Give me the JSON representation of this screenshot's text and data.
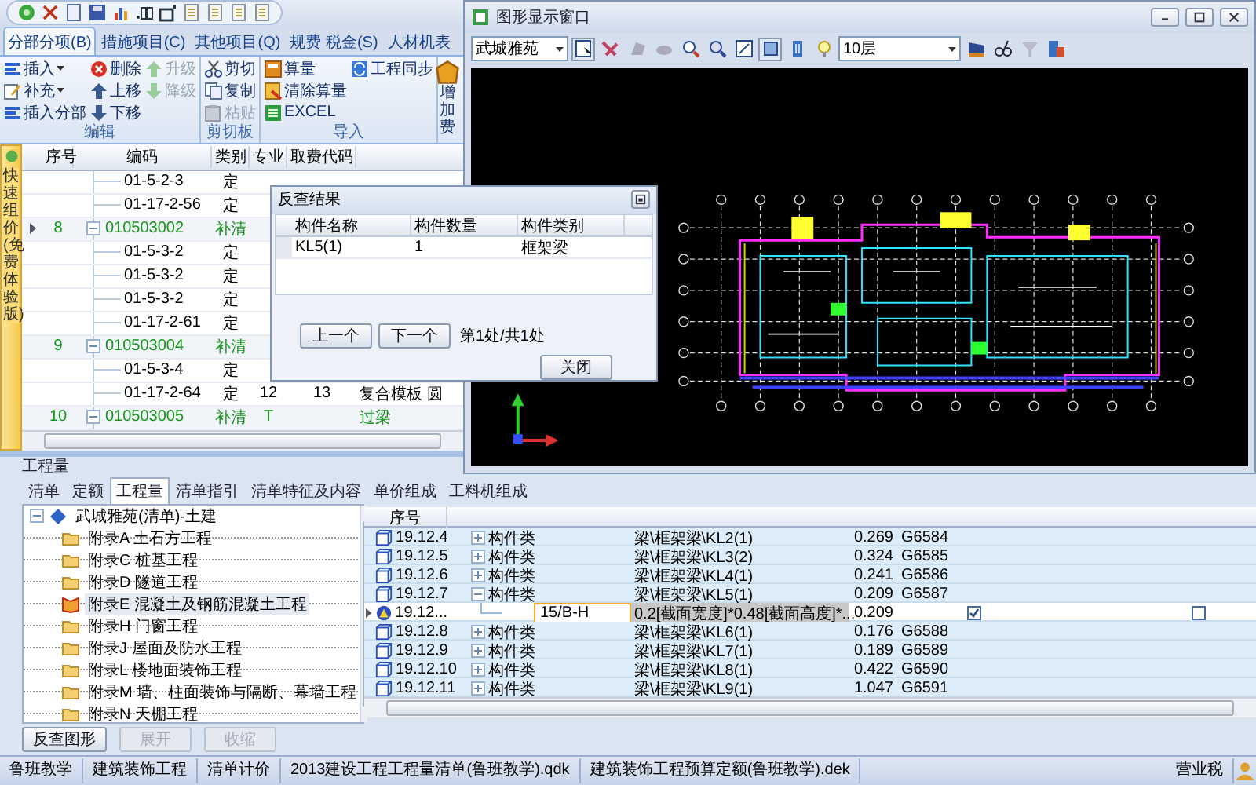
{
  "ribbon_tabs": [
    {
      "label": "分部分项(B)",
      "selected": true
    },
    {
      "label": "措施项目(C)",
      "selected": false
    },
    {
      "label": "其他项目(Q)",
      "selected": false
    },
    {
      "label": "规费 税金(S)",
      "selected": false
    },
    {
      "label": "人材机表",
      "selected": false
    }
  ],
  "ribbon_groups": [
    {
      "label": "编辑",
      "columns": [
        [
          {
            "label": "插入",
            "dropdown": true,
            "disabled": false
          },
          {
            "label": "补充",
            "dropdown": true,
            "disabled": false
          },
          {
            "label": "插入分部",
            "dropdown": false,
            "disabled": false
          }
        ],
        [
          {
            "label": "删除",
            "dropdown": false,
            "disabled": false
          },
          {
            "label": "上移",
            "dropdown": false,
            "disabled": false
          },
          {
            "label": "下移",
            "dropdown": false,
            "disabled": false
          }
        ],
        [
          {
            "label": "升级",
            "dropdown": false,
            "disabled": true
          },
          {
            "label": "降级",
            "dropdown": false,
            "disabled": true
          }
        ]
      ]
    },
    {
      "label": "剪切板",
      "columns": [
        [
          {
            "label": "剪切",
            "dropdown": false,
            "disabled": false
          },
          {
            "label": "复制",
            "dropdown": false,
            "disabled": false
          },
          {
            "label": "粘贴",
            "dropdown": false,
            "disabled": true
          }
        ]
      ]
    },
    {
      "label": "导入",
      "columns": [
        [
          {
            "label": "算量",
            "dropdown": false,
            "disabled": false
          },
          {
            "label": "清除算量",
            "dropdown": false,
            "disabled": false
          },
          {
            "label": "EXCEL",
            "dropdown": false,
            "disabled": false
          }
        ],
        [
          {
            "label": "工程同步",
            "dropdown": false,
            "disabled": false
          }
        ]
      ]
    }
  ],
  "ribbon_large_button": {
    "label": "增加费"
  },
  "side_tab": "快速组价(免费体验版)",
  "upper_grid": {
    "columns": [
      "序号",
      "编码",
      "类别",
      "专业",
      "取费代码"
    ],
    "rows": [
      {
        "kind": "quota",
        "code": "01-5-2-3",
        "type": "定",
        "selected": false
      },
      {
        "kind": "quota",
        "code": "01-17-2-56",
        "type": "定",
        "selected": false
      },
      {
        "kind": "bill",
        "index": "8",
        "code": "010503002",
        "type": "补清",
        "expanded": true,
        "selected": true
      },
      {
        "kind": "quota",
        "code": "01-5-3-2",
        "type": "定",
        "selected": false
      },
      {
        "kind": "quota",
        "code": "01-5-3-2",
        "type": "定",
        "selected": false
      },
      {
        "kind": "quota",
        "code": "01-5-3-2",
        "type": "定",
        "selected": false
      },
      {
        "kind": "quota",
        "code": "01-17-2-61",
        "type": "定",
        "selected": false
      },
      {
        "kind": "bill",
        "index": "9",
        "code": "010503004",
        "type": "补清",
        "expanded": true,
        "selected": false
      },
      {
        "kind": "quota",
        "code": "01-5-3-4",
        "type": "定",
        "selected": false
      },
      {
        "kind": "quota",
        "code": "01-17-2-64",
        "type": "定",
        "specialty": "12",
        "fee_code": "13",
        "name": "复合模板 圆",
        "selected": false
      },
      {
        "kind": "bill",
        "index": "10",
        "code": "010503005",
        "type": "补清",
        "specialty": "T",
        "name": "过梁",
        "expanded": true,
        "selected": false
      }
    ]
  },
  "graphics_window": {
    "title": "图形显示窗口",
    "building": "武城雅苑",
    "floor": "10层"
  },
  "dialog": {
    "title": "反查结果",
    "columns": [
      "构件名称",
      "构件数量",
      "构件类别"
    ],
    "rows": [
      [
        "KL5(1)",
        "1",
        "框架梁"
      ]
    ],
    "buttons": [
      "上一个",
      "下一个"
    ],
    "position": "第1处/共1处",
    "close": "关闭"
  },
  "lower_panel": {
    "title": "工程量",
    "tabs": [
      {
        "label": "清单",
        "selected": false
      },
      {
        "label": "定额",
        "selected": false
      },
      {
        "label": "工程量",
        "selected": true
      },
      {
        "label": "清单指引",
        "selected": false
      },
      {
        "label": "清单特征及内容",
        "selected": false
      },
      {
        "label": "单价组成",
        "selected": false
      },
      {
        "label": "工料机组成",
        "selected": false
      }
    ],
    "tree": {
      "label": "武城雅苑(清单)-土建",
      "expanded": true,
      "children": [
        {
          "label": "附录A 土石方工程",
          "selected": false
        },
        {
          "label": "附录C 桩基工程",
          "selected": false
        },
        {
          "label": "附录D 隧道工程",
          "selected": false
        },
        {
          "label": "附录E 混凝土及钢筋混凝土工程",
          "selected": true
        },
        {
          "label": "附录H 门窗工程",
          "selected": false
        },
        {
          "label": "附录J 屋面及防水工程",
          "selected": false
        },
        {
          "label": "附录L 楼地面装饰工程",
          "selected": false
        },
        {
          "label": "附录M 墙、柱面装饰与隔断、幕墙工程",
          "selected": false
        },
        {
          "label": "附录N 天棚工程",
          "selected": false
        }
      ]
    },
    "buttons": [
      {
        "label": "反查图形",
        "disabled": false
      },
      {
        "label": "展开",
        "disabled": true
      },
      {
        "label": "收缩",
        "disabled": true
      }
    ]
  },
  "lower_grid": {
    "columns": [
      "序号"
    ],
    "rows": [
      {
        "kind": "group",
        "index": "19.12.4",
        "type": "构件类",
        "path": "梁\\框架梁\\KL2(1)",
        "quantity": "0.269",
        "code": "G6584",
        "expanded": false,
        "selected": false
      },
      {
        "kind": "group",
        "index": "19.12.5",
        "type": "构件类",
        "path": "梁\\框架梁\\KL3(2)",
        "quantity": "0.324",
        "code": "G6585",
        "expanded": false,
        "selected": false
      },
      {
        "kind": "group",
        "index": "19.12.6",
        "type": "构件类",
        "path": "梁\\框架梁\\KL4(1)",
        "quantity": "0.241",
        "code": "G6586",
        "expanded": false,
        "selected": false
      },
      {
        "kind": "group",
        "index": "19.12.7",
        "type": "构件类",
        "path": "梁\\框架梁\\KL5(1)",
        "quantity": "0.209",
        "code": "G6587",
        "expanded": true,
        "selected": false
      },
      {
        "kind": "detail",
        "index": "19.12...",
        "position": "15/B-H",
        "formula": "0.2[截面宽度]*0.48[截面高度]*...",
        "quantity": "0.209",
        "selected": true,
        "checks": [
          {
            "checked": true
          },
          {
            "checked": false
          }
        ]
      },
      {
        "kind": "group",
        "index": "19.12.8",
        "type": "构件类",
        "path": "梁\\框架梁\\KL6(1)",
        "quantity": "0.176",
        "code": "G6588",
        "expanded": false,
        "selected": false
      },
      {
        "kind": "group",
        "index": "19.12.9",
        "type": "构件类",
        "path": "梁\\框架梁\\KL7(1)",
        "quantity": "0.189",
        "code": "G6589",
        "expanded": false,
        "selected": false
      },
      {
        "kind": "group",
        "index": "19.12.10",
        "type": "构件类",
        "path": "梁\\框架梁\\KL8(1)",
        "quantity": "0.422",
        "code": "G6590",
        "expanded": false,
        "selected": false
      },
      {
        "kind": "group",
        "index": "19.12.11",
        "type": "构件类",
        "path": "梁\\框架梁\\KL9(1)",
        "quantity": "1.047",
        "code": "G6591",
        "expanded": false,
        "selected": false
      }
    ]
  },
  "status_bar": {
    "items": [
      "鲁班教学",
      "建筑装饰工程",
      "清单计价",
      "2013建设工程工程量清单(鲁班教学).qdk",
      "建筑装饰工程预算定额(鲁班教学).dek"
    ],
    "tax": "营业税"
  }
}
